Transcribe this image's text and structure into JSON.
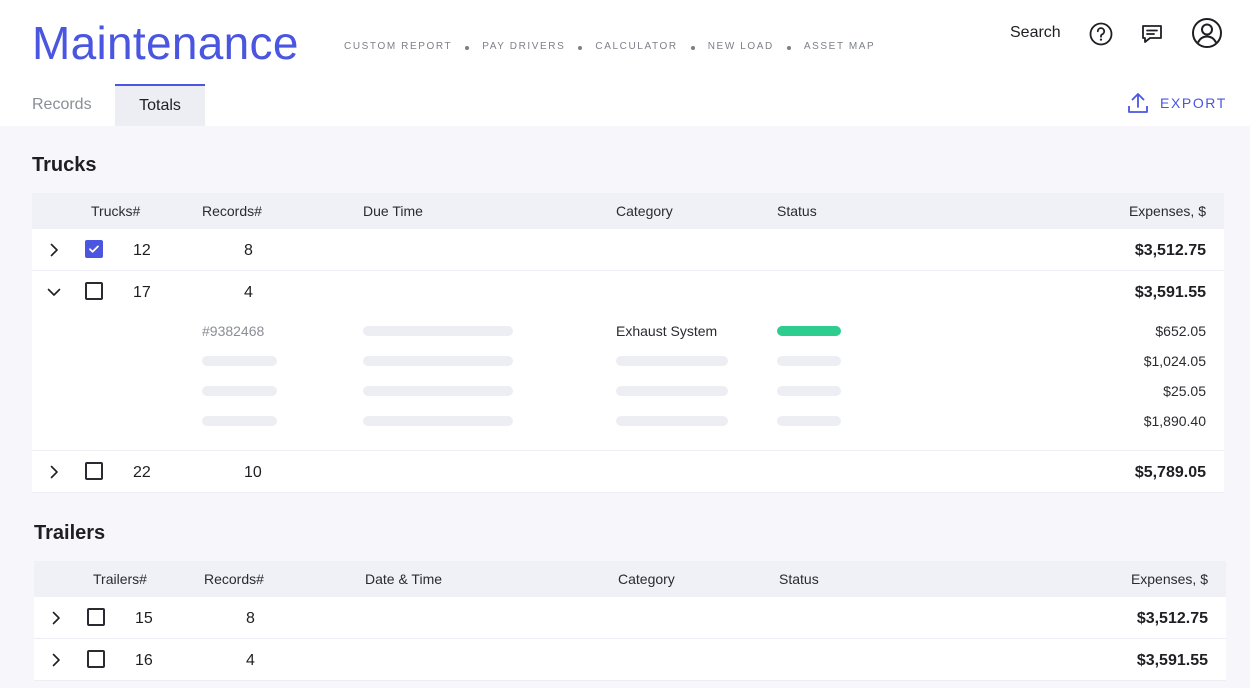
{
  "header": {
    "app_title": "Maintenance",
    "nav": [
      "CUSTOM REPORT",
      "PAY DRIVERS",
      "CALCULATOR",
      "NEW LOAD",
      "ASSET MAP"
    ],
    "search_label": "Search",
    "icons": [
      "help-icon",
      "messages-icon",
      "account-icon"
    ]
  },
  "tabs": {
    "records": "Records",
    "totals": "Totals",
    "active": "Totals"
  },
  "export_label": "EXPORT",
  "colors": {
    "accent": "#4a55e0",
    "status_ok": "#2ecc8f",
    "bg": "#f6f6fb"
  },
  "trucks": {
    "title": "Trucks",
    "columns": {
      "id": "Trucks#",
      "records": "Records#",
      "time": "Due Time",
      "category": "Category",
      "status": "Status",
      "expenses": "Expenses, $"
    },
    "rows": [
      {
        "id": "12",
        "records": "8",
        "expenses": "$3,512.75",
        "checked": true,
        "expanded": false
      },
      {
        "id": "17",
        "records": "4",
        "expenses": "$3,591.55",
        "checked": false,
        "expanded": true
      },
      {
        "id": "22",
        "records": "10",
        "expenses": "$5,789.05",
        "checked": false,
        "expanded": false
      }
    ],
    "detail": {
      "ref": "#9382468",
      "category": "Exhaust System",
      "amounts": [
        "$652.05",
        "$1,024.05",
        "$25.05",
        "$1,890.40"
      ]
    }
  },
  "trailers": {
    "title": "Trailers",
    "columns": {
      "id": "Trailers#",
      "records": "Records#",
      "time": "Date & Time",
      "category": "Category",
      "status": "Status",
      "expenses": "Expenses, $"
    },
    "rows": [
      {
        "id": "15",
        "records": "8",
        "expenses": "$3,512.75",
        "checked": false,
        "expanded": false
      },
      {
        "id": "16",
        "records": "4",
        "expenses": "$3,591.55",
        "checked": false,
        "expanded": false
      }
    ]
  }
}
